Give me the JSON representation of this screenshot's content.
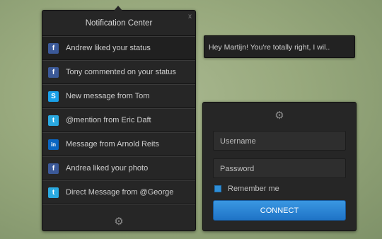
{
  "notification_center": {
    "title": "Notification Center",
    "close_label": "x",
    "items": [
      {
        "icon": "facebook-icon",
        "glyph": "f",
        "text": "Andrew liked your status"
      },
      {
        "icon": "facebook-icon",
        "glyph": "f",
        "text": "Tony commented on your status"
      },
      {
        "icon": "skype-icon",
        "glyph": "S",
        "text": "New message from Tom"
      },
      {
        "icon": "twitter-icon",
        "glyph": "t",
        "text": "@mention from Eric Daft"
      },
      {
        "icon": "linkedin-icon",
        "glyph": "in",
        "text": "Message from Arnold Reits"
      },
      {
        "icon": "facebook-icon",
        "glyph": "f",
        "text": "Andrea liked your photo"
      },
      {
        "icon": "twitter-icon",
        "glyph": "t",
        "text": "Direct Message from @George"
      }
    ],
    "settings_icon": "gear-icon"
  },
  "tooltip": {
    "text": "Hey Martijn! You're totally right, I wil.."
  },
  "login": {
    "settings_icon": "gear-icon",
    "username_placeholder": "Username",
    "password_placeholder": "Password",
    "remember_label": "Remember me",
    "remember_checked": true,
    "connect_label": "CONNECT",
    "accent_color": "#2a86d6"
  }
}
